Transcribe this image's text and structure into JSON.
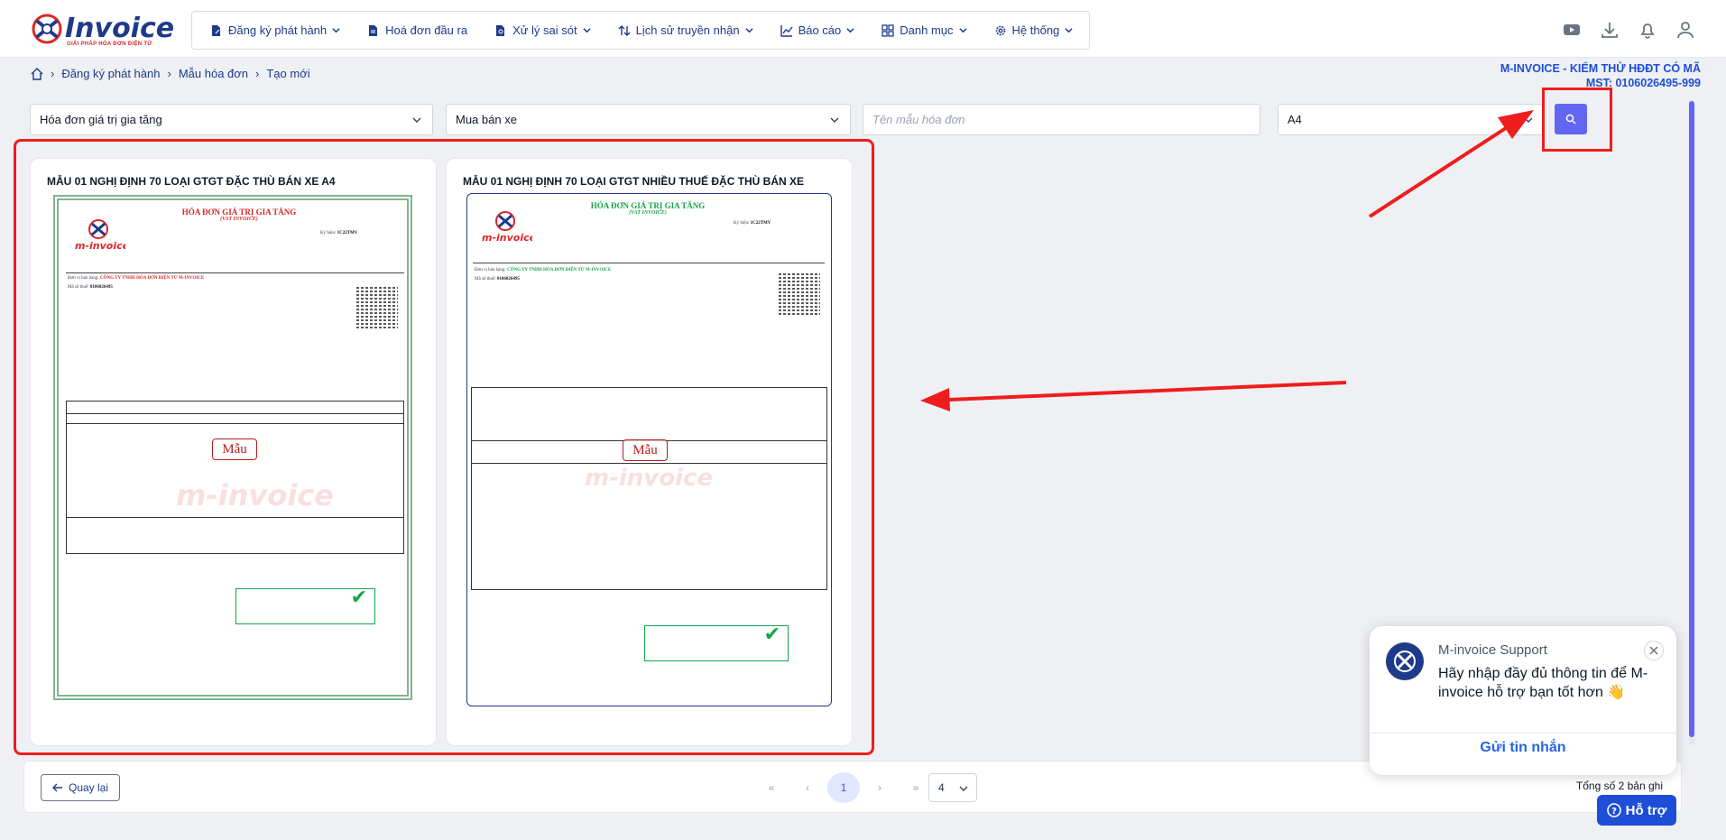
{
  "app": {
    "logo_text": "Invoice",
    "logo_tagline": "GIẢI PHÁP HÓA ĐƠN ĐIỆN TỬ"
  },
  "nav": {
    "items": [
      {
        "label": "Đăng ký phát hành",
        "icon": "file-edit-icon",
        "has_dropdown": true
      },
      {
        "label": "Hoá đơn đầu ra",
        "icon": "file-text-icon",
        "has_dropdown": false
      },
      {
        "label": "Xử lý sai sót",
        "icon": "file-search-icon",
        "has_dropdown": true
      },
      {
        "label": "Lịch sử truyền nhận",
        "icon": "sort-arrows-icon",
        "has_dropdown": true
      },
      {
        "label": "Báo cáo",
        "icon": "chart-line-icon",
        "has_dropdown": true
      },
      {
        "label": "Danh mục",
        "icon": "grid-icon",
        "has_dropdown": true
      },
      {
        "label": "Hệ thống",
        "icon": "gear-icon",
        "has_dropdown": true
      }
    ],
    "right_icons": [
      "youtube-icon",
      "download-icon",
      "bell-icon",
      "user-icon"
    ]
  },
  "breadcrumb": {
    "items": [
      "Đăng ký phát hành",
      "Mẫu hóa đơn",
      "Tạo mới"
    ]
  },
  "company": {
    "name": "M-INVOICE - KIỂM THỬ HĐĐT CÓ MÃ",
    "tax": "MST: 0106026495-999"
  },
  "filters": {
    "invoice_type": "Hóa đơn giá trị gia tăng",
    "category": "Mua bán xe",
    "template_name_placeholder": "Tên mẫu hóa đơn",
    "paper_size": "A4"
  },
  "templates": [
    {
      "title": "MẪU 01 NGHỊ ĐỊNH 70 LOẠI GTGT ĐẶC THÙ BÁN XE A4",
      "invoice_title": "HÓA ĐƠN GIÁ TRỊ GIA TĂNG",
      "invoice_subtitle": "(VAT INVOICE)",
      "serial": "1C22TMV",
      "seller": "CÔNG TY TNHH HÓA ĐƠN ĐIỆN TỬ M-INVOICE",
      "tax_code": "0106026495",
      "stamp": "Mẫu"
    },
    {
      "title": "MẪU 01 NGHỊ ĐỊNH 70 LOẠI GTGT NHIỀU THUẾ ĐẶC THÙ BÁN XE",
      "invoice_title": "HÓA ĐƠN GIÁ TRỊ GIA TĂNG",
      "invoice_subtitle": "(VAT INVOICE)",
      "serial": "1C22TMV",
      "seller": "CÔNG TY TNHH HÓA ĐƠN ĐIỆN TỬ M-INVOICE",
      "tax_code": "0106026495",
      "stamp": "Mẫu"
    }
  ],
  "footer": {
    "back_label": "Quay lại",
    "current_page": "1",
    "page_size": "4",
    "total_text": "Tổng số 2 bản ghi"
  },
  "support": {
    "name": "M-invoice Support",
    "message": "Hãy nhập đầy đủ thông tin để M-invoice hỗ trợ bạn tốt hơn 👋",
    "send_label": "Gửi tin nhắn",
    "help_label": "Hỗ trợ"
  },
  "colors": {
    "brand": "#1e3a8a",
    "accent": "#6366f1",
    "highlight": "#ef1d1d"
  }
}
